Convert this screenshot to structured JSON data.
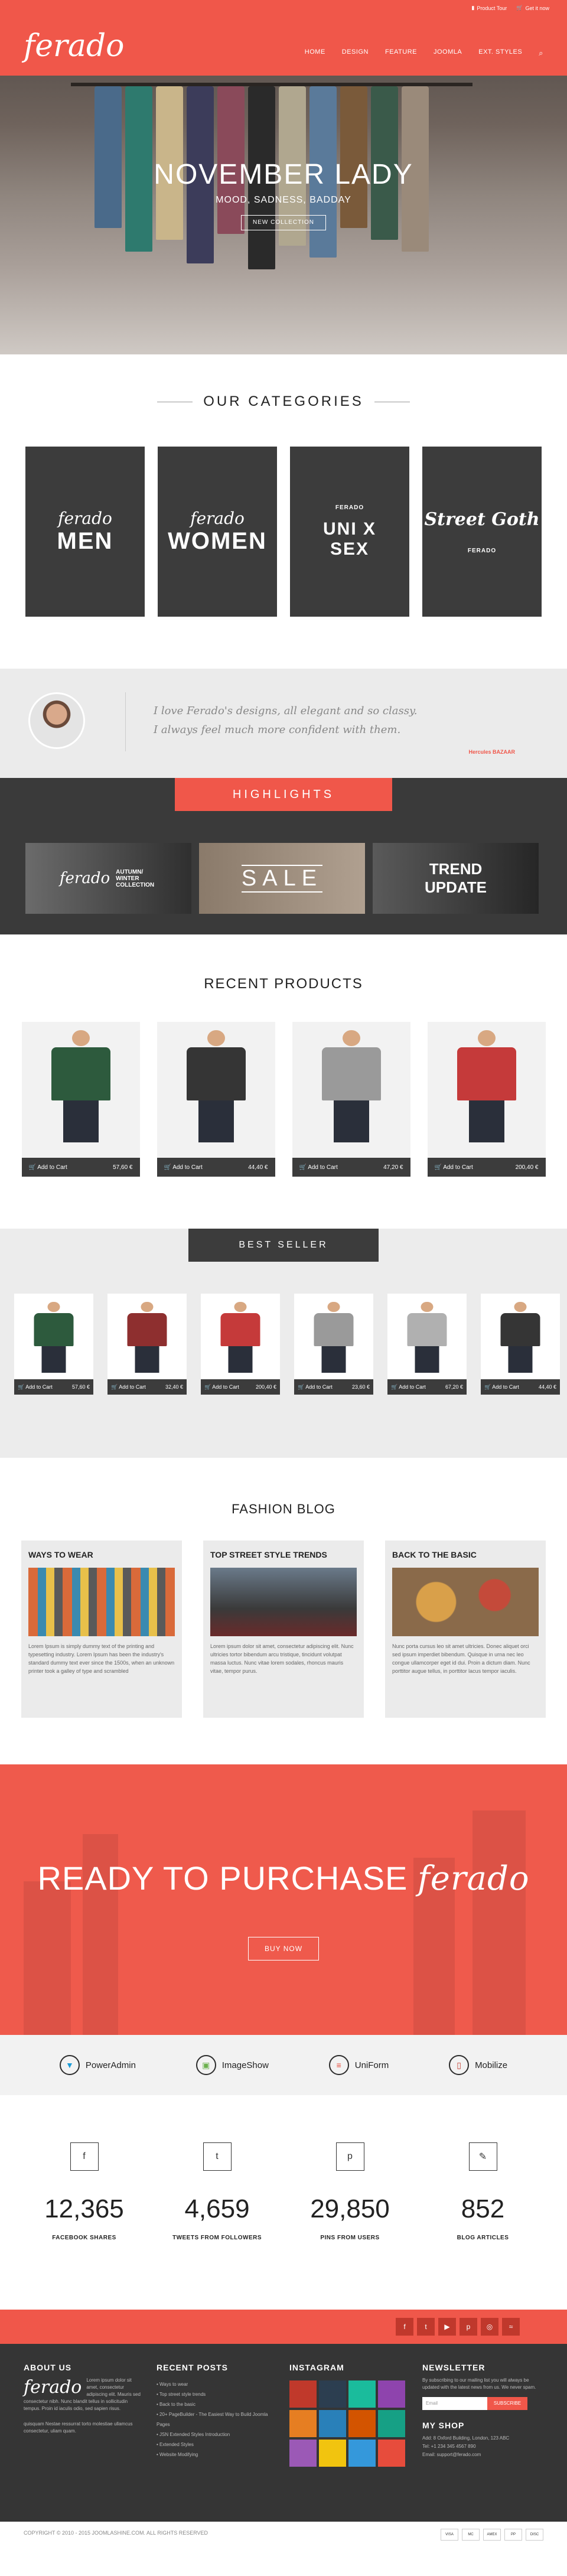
{
  "header": {
    "logo": "ferado",
    "topbar": [
      "Product Tour",
      "Get it now"
    ],
    "nav": [
      "HOME",
      "DESIGN",
      "FEATURE",
      "JOOMLA",
      "EXT. STYLES"
    ]
  },
  "hero": {
    "title": "NOVEMBER LADY",
    "subtitle": "MOOD, SADNESS, BADDAY",
    "button": "NEW COLLECTION"
  },
  "categories": {
    "title": "OUR CATEGORIES",
    "items": [
      {
        "script": "ferado",
        "big": "MEN"
      },
      {
        "script": "ferado",
        "big": "WOMEN"
      },
      {
        "top": "FERADO",
        "big": "UNI X SEX"
      },
      {
        "script": "Street Goth",
        "small": "FERADO"
      }
    ]
  },
  "testimonial": {
    "line1": "I love Ferado's designs, all elegant and so classy.",
    "line2": "I always feel much more confident with them.",
    "author": "Hercules BAZAAR"
  },
  "highlights": {
    "title": "HIGHLIGHTS",
    "banners": [
      {
        "script": "ferado",
        "text": "AUTUMN/ WINTER COLLECTION"
      },
      {
        "text": "SALE"
      },
      {
        "text": "TREND UPDATE"
      }
    ]
  },
  "recent": {
    "title": "RECENT PRODUCTS",
    "add_label": "Add to Cart",
    "prices": [
      "57,60 €",
      "44,40 €",
      "47,20 €",
      "200,40 €"
    ],
    "colors": [
      "#2d5a3d",
      "#353535",
      "#9a9a9a",
      "#c53a3a"
    ]
  },
  "bestseller": {
    "title": "BEST SELLER",
    "add_label": "Add to Cart",
    "prices": [
      "57,60 €",
      "32,40 €",
      "200,40 €",
      "23,60 €",
      "67,20 €",
      "44,40 €"
    ],
    "colors": [
      "#2d5a3d",
      "#8e2f2f",
      "#c53a3a",
      "#9a9a9a",
      "#b0b0b0",
      "#353535"
    ]
  },
  "blog": {
    "title": "FASHION BLOG",
    "posts": [
      {
        "title": "WAYS TO WEAR",
        "text": "Lorem Ipsum is simply dummy text of the printing and typesetting industry. Lorem Ipsum has been the industry's standard dummy text ever since the 1500s, when an unknown printer took a galley of type and scrambled"
      },
      {
        "title": "TOP STREET STYLE TRENDS",
        "text": "Lorem ipsum dolor sit amet, consectetur adipiscing elit. Nunc ultricies tortor bibendum arcu tristique, tincidunt volutpat massa luctus. Nunc vitae lorem sodales, rhoncus mauris vitae, tempor purus."
      },
      {
        "title": "BACK TO THE BASIC",
        "text": "Nunc porta cursus leo sit amet ultricies. Donec aliquet orci sed ipsum imperdiet bibendum. Quisque in urna nec leo congue ullamcorper eget id dui. Proin a dictum diam. Nunc porttitor augue tellus, in porttitor lacus tempor iaculis."
      }
    ]
  },
  "cta": {
    "title": "READY TO PURCHASE",
    "logo": "ferado",
    "button": "BUY NOW"
  },
  "partners": [
    "PowerAdmin",
    "ImageShow",
    "UniForm",
    "Mobilize"
  ],
  "stats": [
    {
      "num": "12,365",
      "label": "FACEBOOK SHARES",
      "icon": "f"
    },
    {
      "num": "4,659",
      "label": "TWEETS FROM FOLLOWERS",
      "icon": "t"
    },
    {
      "num": "29,850",
      "label": "PINS FROM USERS",
      "icon": "p"
    },
    {
      "num": "852",
      "label": "BLOG ARTICLES",
      "icon": "✎"
    }
  ],
  "footer": {
    "about_title": "ABOUT US",
    "about_logo": "ferado",
    "about_text": "Lorem ipsum dolor sit amet, consectetur adipiscing elit. Mauris sed consectetur nibh. Nunc blandit tellus in sollicitudin tempus. Proin id iaculis odio, sed sapien risus.",
    "about_text2": "quisquam Nestae ressurrat torto molestiae ullamcus consectetur, uliam quam.",
    "recent_title": "RECENT POSTS",
    "recent": [
      "Ways to wear",
      "Top street style trends",
      "Back to the basic",
      "20+ PageBuilder - The Easiest Way to Build Joomla Pages",
      "JSN Extended Styles Introduction",
      "Extended Styles",
      "Website Modifying"
    ],
    "insta_title": "INSTAGRAM",
    "newsletter_title": "NEWSLETTER",
    "newsletter_text": "By subscribing to our mailing list you will always be updated with the latest news from us. We never spam.",
    "email_placeholder": "Email",
    "subscribe": "SUBSCRIBE",
    "shop_title": "MY SHOP",
    "shop_lines": [
      "Add: 8 Oxford Building, London, 123 ABC",
      "Tel: +1 234 345 4567 890",
      "Email: support@ferado.com"
    ],
    "copyright": "COPYRIGHT © 2010 - 2015 JOOMLASHINE.COM. ALL RIGHTS RESERVED",
    "payments": [
      "VISA",
      "MC",
      "AMEX",
      "PP",
      "DISC"
    ]
  }
}
